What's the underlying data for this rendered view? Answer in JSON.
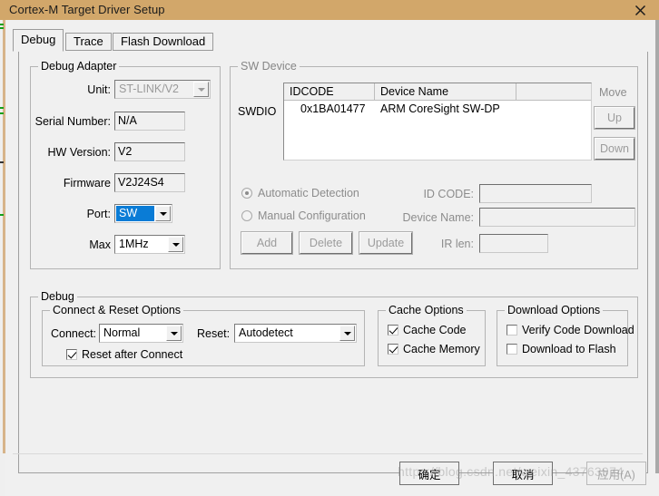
{
  "window": {
    "title": "Cortex-M Target Driver Setup",
    "close_icon": "close-icon",
    "titlebar_color": "#d2a76a"
  },
  "tabs": [
    {
      "label": "Debug",
      "active": true
    },
    {
      "label": "Trace",
      "active": false
    },
    {
      "label": "Flash Download",
      "active": false
    }
  ],
  "debug_adapter": {
    "legend": "Debug Adapter",
    "unit_label": "Unit:",
    "unit_value": "ST-LINK/V2",
    "serial_label": "Serial Number:",
    "serial_value": "N/A",
    "hw_label": "HW Version:",
    "hw_value": "V2",
    "firmware_label": "Firmware",
    "firmware_value": "V2J24S4",
    "port_label": "Port:",
    "port_value": "SW",
    "max_label": "Max",
    "max_value": "1MHz",
    "selection_color": "#0a7cd6"
  },
  "sw_device": {
    "legend": "SW Device",
    "interface_label": "SWDIO",
    "columns": [
      "IDCODE",
      "Device Name",
      ""
    ],
    "rows": [
      {
        "idcode": "0x1BA01477",
        "device_name": "ARM CoreSight SW-DP"
      }
    ],
    "move_label": "Move",
    "up_label": "Up",
    "down_label": "Down",
    "automatic_detection": "Automatic Detection",
    "manual_configuration": "Manual Configuration",
    "id_code_label": "ID CODE:",
    "id_code_value": "",
    "device_name_label": "Device Name:",
    "device_name_value": "",
    "ir_len_label": "IR len:",
    "ir_len_value": "",
    "add_label": "Add",
    "delete_label": "Delete",
    "update_label": "Update"
  },
  "debug": {
    "legend": "Debug",
    "connect_reset": {
      "legend": "Connect & Reset Options",
      "connect_label": "Connect:",
      "connect_value": "Normal",
      "reset_label": "Reset:",
      "reset_value": "Autodetect",
      "reset_after_connect_label": "Reset after Connect",
      "reset_after_connect_checked": true
    },
    "cache_options": {
      "legend": "Cache Options",
      "cache_code_label": "Cache Code",
      "cache_code_checked": true,
      "cache_memory_label": "Cache Memory",
      "cache_memory_checked": true
    },
    "download_options": {
      "legend": "Download Options",
      "verify_code_label": "Verify Code Download",
      "verify_code_checked": false,
      "download_flash_label": "Download to Flash",
      "download_flash_checked": false
    }
  },
  "dialog_buttons": {
    "ok": "确定",
    "cancel": "取消",
    "apply": "应用(A)"
  },
  "watermark": "https://blog.csdn.net/weixin_43763974"
}
